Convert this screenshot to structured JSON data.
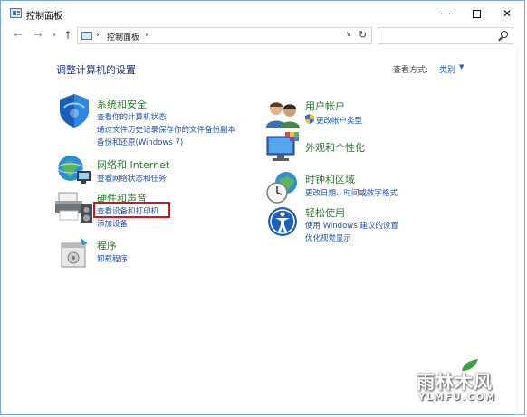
{
  "window": {
    "title": "控制面板",
    "controls": {
      "minimize": "minimize-icon",
      "maximize": "maximize-icon",
      "close": "✕"
    }
  },
  "address": {
    "crumb": "控制面板",
    "separator": "›"
  },
  "search": {
    "placeholder": ""
  },
  "content": {
    "heading": "调整计算机的设置",
    "view_by_label": "查看方式:",
    "view_mode": "类别"
  },
  "categories": {
    "system": {
      "title": "系统和安全",
      "links": [
        "查看你的计算机状态",
        "通过文件历史记录保存你的文件备份副本",
        "备份和还原(Windows 7)"
      ]
    },
    "network": {
      "title": "网络和 Internet",
      "links": [
        "查看网络状态和任务"
      ]
    },
    "hardware": {
      "title": "硬件和声音",
      "links": [
        "查看设备和打印机",
        "添加设备"
      ]
    },
    "programs": {
      "title": "程序",
      "links": [
        "卸载程序"
      ]
    },
    "accounts": {
      "title": "用户帐户",
      "links": [
        "更改帐户类型"
      ]
    },
    "appearance": {
      "title": "外观和个性化",
      "links": []
    },
    "clock": {
      "title": "时钟和区域",
      "links": [
        "更改日期、时间或数字格式"
      ]
    },
    "ease": {
      "title": "轻松使用",
      "links": [
        "使用 Windows 建议的设置",
        "优化视觉显示"
      ]
    }
  },
  "watermark": {
    "text": "雨林木风",
    "sub": "YLMFU.COM"
  },
  "colors": {
    "category_title": "#2d7a2d",
    "link": "#1e4fb5",
    "heading": "#1e3287",
    "highlight": "#d6141e"
  }
}
